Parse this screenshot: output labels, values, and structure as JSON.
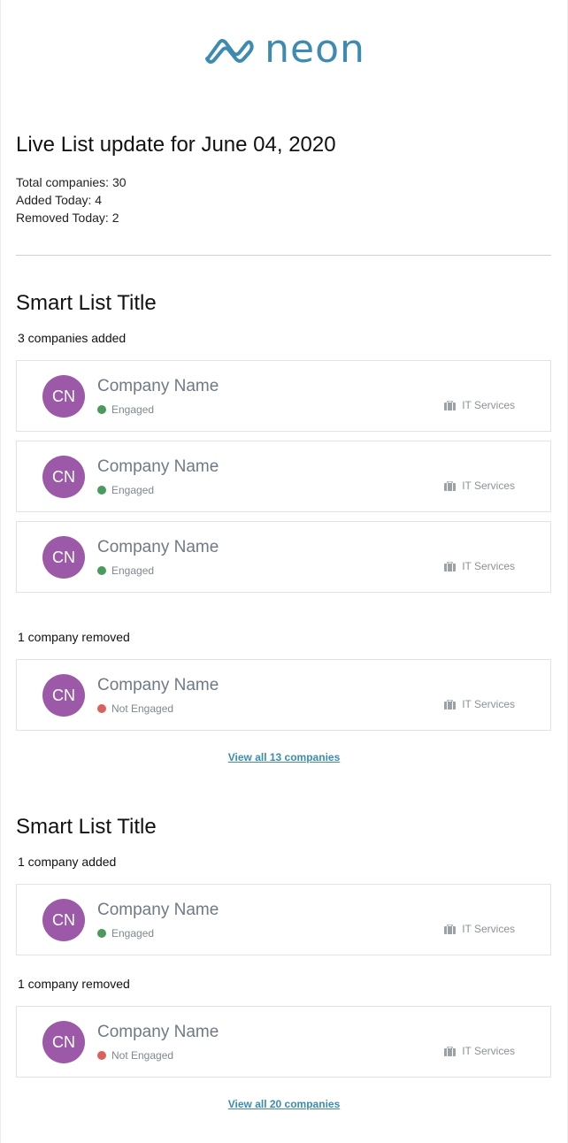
{
  "brand": {
    "name": "neon",
    "color": "#3d8bb0"
  },
  "headline": "Live List update for June 04, 2020",
  "stats": {
    "total": "Total companies:  30",
    "added": "Added Today: 4",
    "removed": "Removed Today: 2"
  },
  "lists": [
    {
      "title": "Smart List Title",
      "added_label": "3 companies added",
      "added": [
        {
          "initials": "CN",
          "name": "Company Name",
          "status": "Engaged",
          "industry": "IT Services"
        },
        {
          "initials": "CN",
          "name": "Company Name",
          "status": "Engaged",
          "industry": "IT Services"
        },
        {
          "initials": "CN",
          "name": "Company Name",
          "status": "Engaged",
          "industry": "IT Services"
        }
      ],
      "removed_label": "1 company removed",
      "removed": [
        {
          "initials": "CN",
          "name": "Company Name",
          "status": "Not Engaged",
          "industry": "IT Services"
        }
      ],
      "view_all": "View all 13 companies"
    },
    {
      "title": "Smart List Title",
      "added_label": "1 company added",
      "added": [
        {
          "initials": "CN",
          "name": "Company Name",
          "status": "Engaged",
          "industry": "IT Services"
        }
      ],
      "removed_label": "1 company removed",
      "removed": [
        {
          "initials": "CN",
          "name": "Company Name",
          "status": "Not Engaged",
          "industry": "IT Services"
        }
      ],
      "view_all": "View all 20 companies"
    }
  ],
  "colors": {
    "avatar": "#9b59a7",
    "engaged": "#4a9a5c",
    "not_engaged": "#d9635c",
    "link": "#3d8bb0"
  },
  "icons": {
    "logo": "neon-logo-icon",
    "industry": "briefcase-icon"
  }
}
